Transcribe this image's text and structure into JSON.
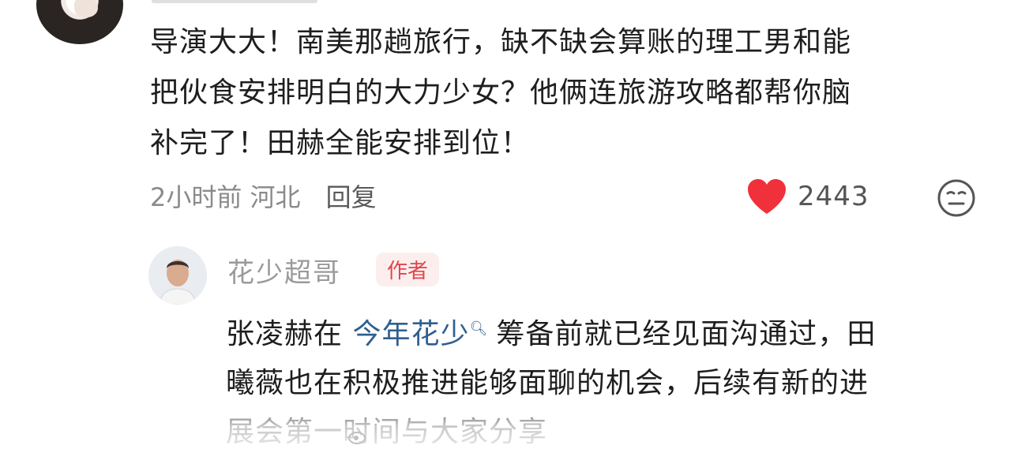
{
  "comment": {
    "lines": [
      "导演大大！南美那趟旅行，缺不缺会算账的理工男和能",
      "把伙食安排明白的大力少女？他俩连旅游攻略都帮你脑",
      "补完了！田赫全能安排到位！"
    ],
    "time": "2小时前",
    "location": "河北",
    "reply_label": "回复",
    "likes": "2443",
    "like_icon": "heart-icon",
    "emoji_icon": "neutral-face-icon"
  },
  "reply": {
    "author": "花少超哥",
    "badge": "作者",
    "text_before_link": "张凌赫在 ",
    "topic_link": "今年花少",
    "text_after_link": "筹备前就已经见面沟通过，田",
    "line2": "曦薇也在积极推进能够面聊的机会，后续有新的进",
    "line3": "展会第一时间与大家分享"
  },
  "colors": {
    "like_red": "#f0303a",
    "link_blue": "#2f5f8f",
    "badge_bg": "#fdeeee",
    "badge_text": "#e0454b",
    "meta_gray": "#8a8a8a"
  }
}
